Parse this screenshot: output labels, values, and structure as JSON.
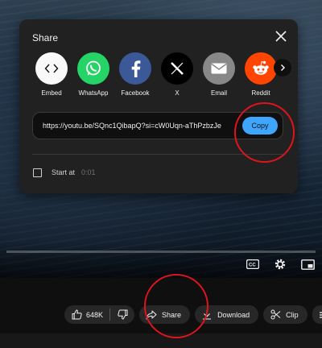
{
  "dialog": {
    "title": "Share",
    "options": [
      {
        "label": "Embed",
        "icon": "embed-icon",
        "bg": "#f9f9f9"
      },
      {
        "label": "WhatsApp",
        "icon": "whatsapp-icon",
        "bg": "#25d366"
      },
      {
        "label": "Facebook",
        "icon": "facebook-icon",
        "bg": "#3b5998"
      },
      {
        "label": "X",
        "icon": "x-icon",
        "bg": "#000000"
      },
      {
        "label": "Email",
        "icon": "email-icon",
        "bg": "#888888"
      },
      {
        "label": "Reddit",
        "icon": "reddit-icon",
        "bg": "#ff4500"
      }
    ],
    "url": "https://youtu.be/SQnc1QibapQ?si=cW0Uqn-aThPzbzJe",
    "copy_label": "Copy",
    "start_at_label": "Start at",
    "start_time": "0:01"
  },
  "actions": {
    "like_count": "648K",
    "share_label": "Share",
    "download_label": "Download",
    "clip_label": "Clip"
  },
  "colors": {
    "accent": "#3ea6ff",
    "annotation": "#e0141d",
    "dialog_bg": "#212121",
    "pill_bg": "#272727"
  }
}
